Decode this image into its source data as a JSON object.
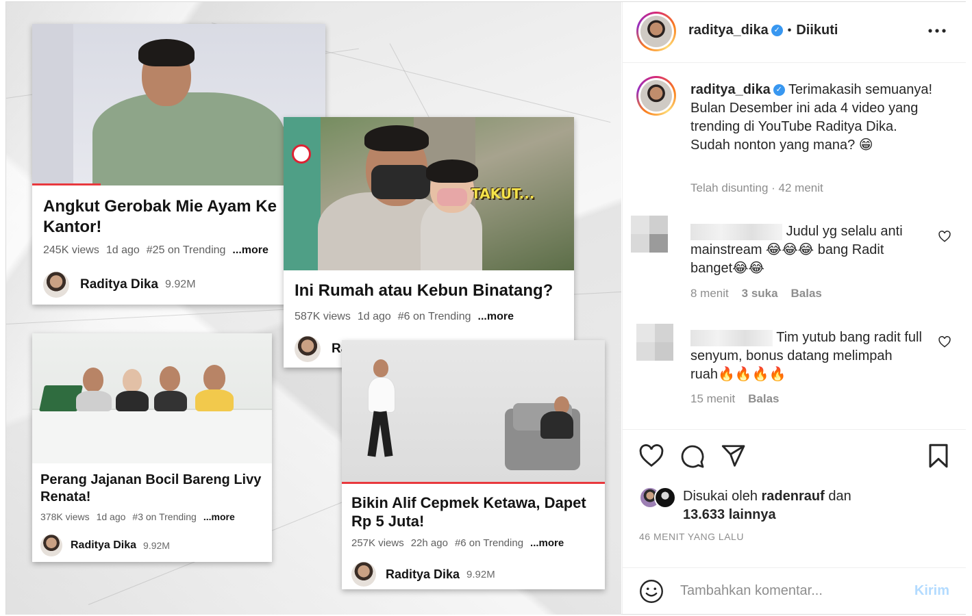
{
  "header": {
    "username": "raditya_dika",
    "follow_status": "Diikuti"
  },
  "post_image": {
    "cards": [
      {
        "title": "Angkut Gerobak Mie Ayam Ke Kantor!",
        "views": "245K views",
        "age": "1d ago",
        "trending": "#25 on Trending",
        "more": "...more",
        "channel": "Raditya Dika",
        "subs": "9.92M"
      },
      {
        "title": "Ini Rumah atau Kebun Binatang?",
        "views": "587K views",
        "age": "1d ago",
        "trending": "#6 on Trending",
        "more": "...more",
        "channel": "Ra",
        "overlay_text": "TAKUT..."
      },
      {
        "title": "Perang Jajanan Bocil Bareng Livy Renata!",
        "views": "378K views",
        "age": "1d ago",
        "trending": "#3 on Trending",
        "more": "...more",
        "channel": "Raditya Dika",
        "subs": "9.92M"
      },
      {
        "title": "Bikin Alif Cepmek Ketawa, Dapet Rp 5 Juta!",
        "views": "257K views",
        "age": "22h ago",
        "trending": "#6 on Trending",
        "more": "...more",
        "channel": "Raditya Dika",
        "subs": "9.92M"
      }
    ]
  },
  "caption": {
    "username": "raditya_dika",
    "text": "Terimakasih semuanya! Bulan Desember ini ada 4 video yang trending di YouTube Raditya Dika. Sudah nonton yang mana? 😁",
    "meta": "Telah disunting · 42 menit"
  },
  "comments": [
    {
      "text": "Judul yg selalu anti mainstream 😂😂😂 bang Radit banget😂😂",
      "time": "8 menit",
      "likes": "3 suka",
      "reply": "Balas"
    },
    {
      "text": "Tim yutub bang radit full senyum, bonus datang melimpah ruah🔥🔥🔥🔥",
      "time": "15 menit",
      "reply": "Balas"
    }
  ],
  "likes": {
    "prefix": "Disukai oleh ",
    "user": "radenrauf",
    "middle": " dan",
    "others": "13.633 lainnya"
  },
  "posted_ago": "46 MENIT YANG LALU",
  "comment_box": {
    "placeholder": "Tambahkan komentar...",
    "post_label": "Kirim"
  },
  "colors": {
    "verified": "#3897f0",
    "youtube_progress": "#e8383d",
    "post_button_disabled": "#b3dbff"
  },
  "icons": [
    "verified-badge-icon",
    "more-options-icon",
    "heart-icon",
    "comment-icon",
    "share-icon",
    "bookmark-icon",
    "emoji-icon"
  ]
}
